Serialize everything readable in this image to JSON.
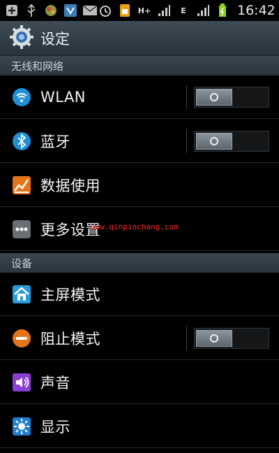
{
  "statusbar": {
    "time": "16:42",
    "network_label": "H+",
    "network_label2": "E",
    "left_icons": [
      "add-icon",
      "usb-icon",
      "app-icon",
      "shield-icon",
      "mail-icon"
    ],
    "right_icons": [
      "alarm-icon",
      "sim-icon",
      "signal-icon",
      "signal2-icon",
      "battery-icon"
    ]
  },
  "titlebar": {
    "title": "设定"
  },
  "sections": [
    {
      "header": "无线和网络",
      "items": [
        {
          "label": "WLAN",
          "icon": "wifi-icon",
          "toggle": true
        },
        {
          "label": "蓝牙",
          "icon": "bluetooth-icon",
          "toggle": true
        },
        {
          "label": "数据使用",
          "icon": "data-usage-icon",
          "toggle": false
        },
        {
          "label": "更多设置",
          "icon": "more-icon",
          "toggle": false
        }
      ]
    },
    {
      "header": "设备",
      "items": [
        {
          "label": "主屏模式",
          "icon": "home-icon",
          "toggle": false
        },
        {
          "label": "阻止模式",
          "icon": "block-icon",
          "toggle": true
        },
        {
          "label": "声音",
          "icon": "sound-icon",
          "toggle": false
        },
        {
          "label": "显示",
          "icon": "display-icon",
          "toggle": false
        }
      ]
    }
  ],
  "watermark": "www.qinpinchang.com",
  "colors": {
    "accent": "#1e8fd8",
    "section_bg": "#333d46",
    "watermark": "#ff2a2a"
  }
}
